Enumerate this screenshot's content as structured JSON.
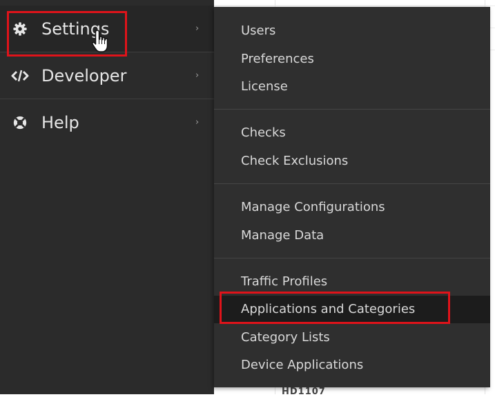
{
  "nav": {
    "items": [
      {
        "label": "Settings",
        "icon": "gear-icon"
      },
      {
        "label": "Developer",
        "icon": "code-icon"
      },
      {
        "label": "Help",
        "icon": "lifebuoy-icon"
      }
    ],
    "chevron": "›"
  },
  "submenu": {
    "groups": [
      [
        "Users",
        "Preferences",
        "License"
      ],
      [
        "Checks",
        "Check Exclusions"
      ],
      [
        "Manage Configurations",
        "Manage Data"
      ],
      [
        "Traffic Profiles",
        "Applications and Categories",
        "Category Lists",
        "Device Applications"
      ]
    ]
  },
  "background": {
    "cut_text": "HD1107"
  },
  "colors": {
    "nav_bg": "#2b2b2b",
    "submenu_bg": "#2f2f2f",
    "selected_bg": "#1c1c1c",
    "highlight": "#e0131a"
  }
}
